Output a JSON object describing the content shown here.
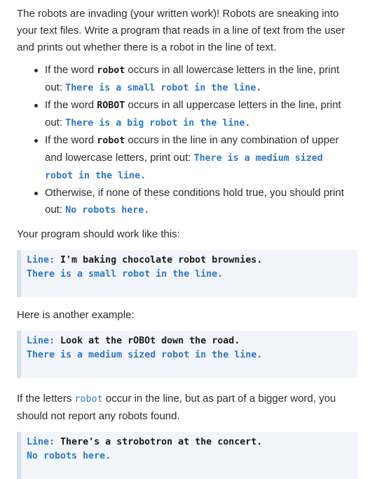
{
  "intro": "The robots are invading (your written work)! Robots are sneaking into your text files. Write a program that reads in a line of text from the user and prints out whether there is a robot in the line of text.",
  "rules": [
    {
      "before": "If the word ",
      "keyword": "robot",
      "after": " occurs in all lowercase letters in the line, print out: ",
      "output": "There is a small robot in the line."
    },
    {
      "before": "If the word ",
      "keyword": "ROBOT",
      "after": " occurs in all uppercase letters in the line, print out: ",
      "output": "There is a big robot in the line."
    },
    {
      "before": "If the word ",
      "keyword": "robot",
      "after": " occurs in the line in any combination of upper and lowercase letters, print out: ",
      "output": "There is a medium sized robot in the line."
    },
    {
      "before": "Otherwise, if none of these conditions hold true, you should print out: ",
      "keyword": "",
      "after": "",
      "output": "No robots here."
    }
  ],
  "example1": {
    "label": "Your program should work like this:",
    "prompt": "Line: ",
    "input": "I'm baking chocolate robot brownies.",
    "response": "There is a small robot in the line."
  },
  "example2": {
    "label": "Here is another example:",
    "prompt": "Line: ",
    "input": "Look at the rOBOt down the road.",
    "response": "There is a medium sized robot in the line."
  },
  "note": {
    "before": "If the letters ",
    "keyword": "robot",
    "after": " occur in the line, but as part of a bigger word, you should not report any robots found."
  },
  "example3": {
    "prompt": "Line: ",
    "input": "There's a strobotron at the concert.",
    "response": "No robots here."
  }
}
